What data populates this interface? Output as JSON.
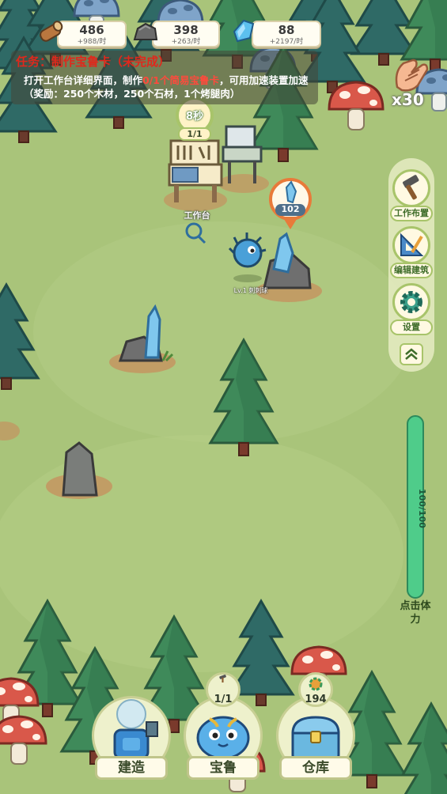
{
  "resources": [
    {
      "name": "wood",
      "value": "486",
      "rate": "+988/时",
      "icon": "log-icon"
    },
    {
      "name": "stone",
      "value": "398",
      "rate": "+263/时",
      "icon": "stone-icon"
    },
    {
      "name": "crystal",
      "value": "88",
      "rate": "+2197/时",
      "icon": "crystal-icon"
    }
  ],
  "quest": {
    "title": "任务：制作宝鲁卡（未完成）",
    "body_1": "打开工作台详细界面，制作",
    "body_red": "0/1个简易宝鲁卡",
    "body_2": "，可用加速装置加速（奖励：250个木材，250个石材，1个烤腿肉）"
  },
  "clap": {
    "count": "x30"
  },
  "workbench": {
    "timer": "8秒",
    "count": "1/1",
    "label": "工作台"
  },
  "crystal_node": {
    "value": "102"
  },
  "pet": {
    "label": "Lv.1 刺刺球"
  },
  "side_menu": {
    "layout": "工作布置",
    "edit": "编辑建筑",
    "settings": "设置"
  },
  "stamina": {
    "value": "100/100",
    "label": "点击体力"
  },
  "bottom": {
    "build": "建造",
    "pet": "宝鲁",
    "pet_badge": "1/1",
    "storage": "仓库",
    "storage_badge": "194"
  },
  "colors": {
    "grass": "#a9c47a",
    "accent_red": "#e0281c",
    "stamina": "#4fcc8a",
    "panel_border": "#a8c46a"
  }
}
